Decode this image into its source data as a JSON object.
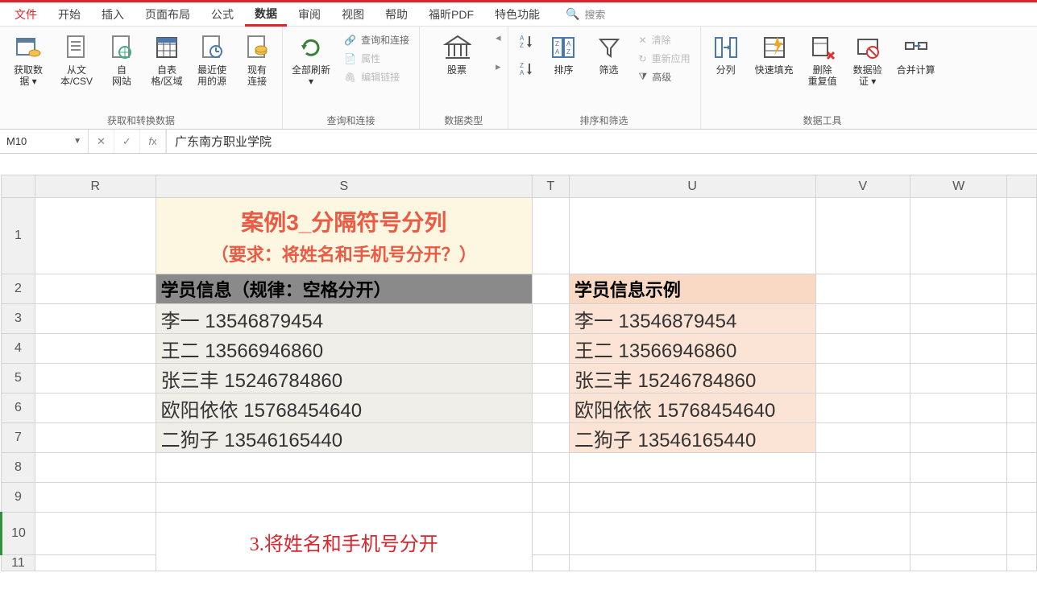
{
  "menu": {
    "tabs": {
      "file": "文件",
      "home": "开始",
      "insert": "插入",
      "layout": "页面布局",
      "formula": "公式",
      "data": "数据",
      "review": "审阅",
      "view": "视图",
      "help": "帮助",
      "pdf": "福昕PDF",
      "special": "特色功能"
    },
    "search_placeholder": "搜索"
  },
  "ribbon": {
    "group_get": {
      "label": "获取和转换数据",
      "get_data": "获取数\n据 ▾",
      "from_csv": "从文\n本/CSV",
      "from_web": "自\n网站",
      "from_table": "自表\n格/区域",
      "recent": "最近使\n用的源",
      "existing": "现有\n连接"
    },
    "group_query": {
      "label": "查询和连接",
      "refresh": "全部刷新\n▾",
      "queries": "查询和连接",
      "props": "属性",
      "editlinks": "编辑链接"
    },
    "group_datatype": {
      "label": "数据类型",
      "stocks": "股票"
    },
    "group_sort": {
      "label": "排序和筛选",
      "sort": "排序",
      "filter": "筛选",
      "clear": "清除",
      "reapply": "重新应用",
      "advanced": "高级"
    },
    "group_tools": {
      "label": "数据工具",
      "text2col": "分列",
      "flash": "快速填充",
      "dupe": "删除\n重复值",
      "validate": "数据验\n证 ▾",
      "consolidate": "合并计算"
    }
  },
  "formula_bar": {
    "name_box": "M10",
    "content": "广东南方职业学院"
  },
  "columns": [
    "R",
    "S",
    "T",
    "U",
    "V",
    "W"
  ],
  "col_widths": {
    "rowhdr": 42,
    "R": 150,
    "S": 468,
    "T": 46,
    "U": 306,
    "V": 118,
    "W": 120,
    "tail": 37
  },
  "sheet": {
    "title_line1": "案例3_分隔符号分列",
    "title_line2": "（要求：将姓名和手机号分开？）",
    "hdr_left": "学员信息（规律：空格分开）",
    "hdr_right": "学员信息示例",
    "rows": [
      {
        "s": "李一 13546879454",
        "u": "李一 13546879454"
      },
      {
        "s": "王二 13566946860",
        "u": "王二 13566946860"
      },
      {
        "s": "张三丰 15246784860",
        "u": "张三丰 15246784860"
      },
      {
        "s": "欧阳依依 15768454640",
        "u": "欧阳依依 15768454640"
      },
      {
        "s": "二狗子 13546165440",
        "u": "二狗子 13546165440"
      }
    ],
    "note": "3.将姓名和手机号分开"
  }
}
